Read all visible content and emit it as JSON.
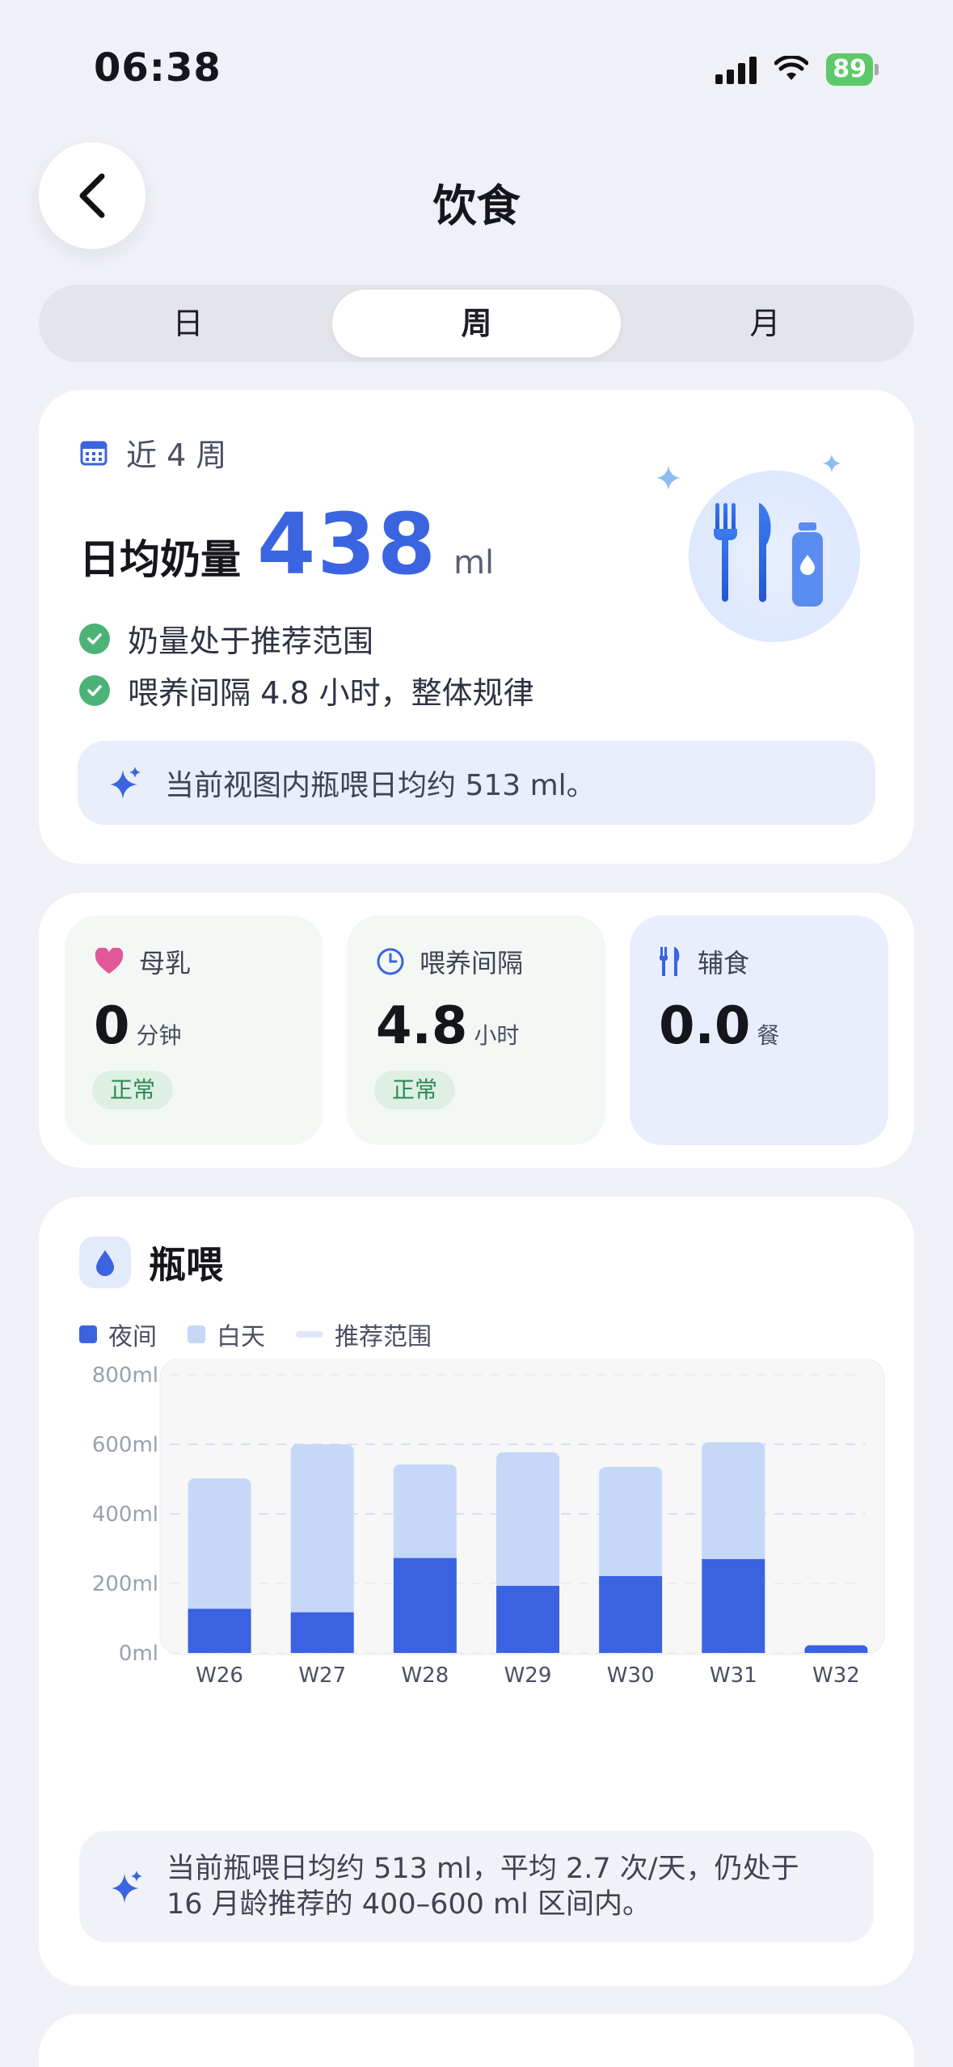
{
  "status_bar": {
    "time": "06:38",
    "battery": "89"
  },
  "header": {
    "title": "饮食"
  },
  "segments": [
    "日",
    "周",
    "月"
  ],
  "active_segment": "周",
  "summary": {
    "period": "近 4 周",
    "daily_label": "日均奶量",
    "daily_value": "438",
    "daily_unit": "ml",
    "checks": [
      "奶量处于推荐范围",
      "喂养间隔 4.8 小时，整体规律"
    ],
    "note": "当前视图内瓶喂日均约 513 ml。"
  },
  "stats": [
    {
      "label": "母乳",
      "value": "0",
      "unit": "分钟",
      "badge": "正常",
      "icon": "heart-icon"
    },
    {
      "label": "喂养间隔",
      "value": "4.8",
      "unit": "小时",
      "badge": "正常",
      "icon": "clock-icon"
    },
    {
      "label": "辅食",
      "value": "0.0",
      "unit": "餐",
      "badge": "",
      "icon": "utensils-icon"
    }
  ],
  "bottle": {
    "title": "瓶喂",
    "legend": [
      "夜间",
      "白天",
      "推荐范围"
    ],
    "note_line1": "当前瓶喂日均约 513 ml，平均 2.7 次/天，仍处于",
    "note_line2": "16 月龄推荐的 400–600 ml 区间内。"
  },
  "colors": {
    "night": "#3b63e1",
    "day": "#c5d8f8",
    "accent": "#3a64e0",
    "ok": "#4cb378"
  },
  "chart_data": {
    "type": "bar",
    "stacked": true,
    "categories": [
      "W26",
      "W27",
      "W28",
      "W29",
      "W30",
      "W31",
      "W32"
    ],
    "series": [
      {
        "name": "夜间",
        "values": [
          127,
          117,
          273,
          193,
          221,
          270,
          22
        ]
      },
      {
        "name": "白天",
        "values": [
          375,
          483,
          269,
          384,
          314,
          336,
          0
        ]
      }
    ],
    "y_ticks": [
      "0ml",
      "200ml",
      "400ml",
      "600ml",
      "800ml"
    ],
    "ylim": [
      0,
      800
    ],
    "recommended_range": [
      400,
      600
    ]
  }
}
